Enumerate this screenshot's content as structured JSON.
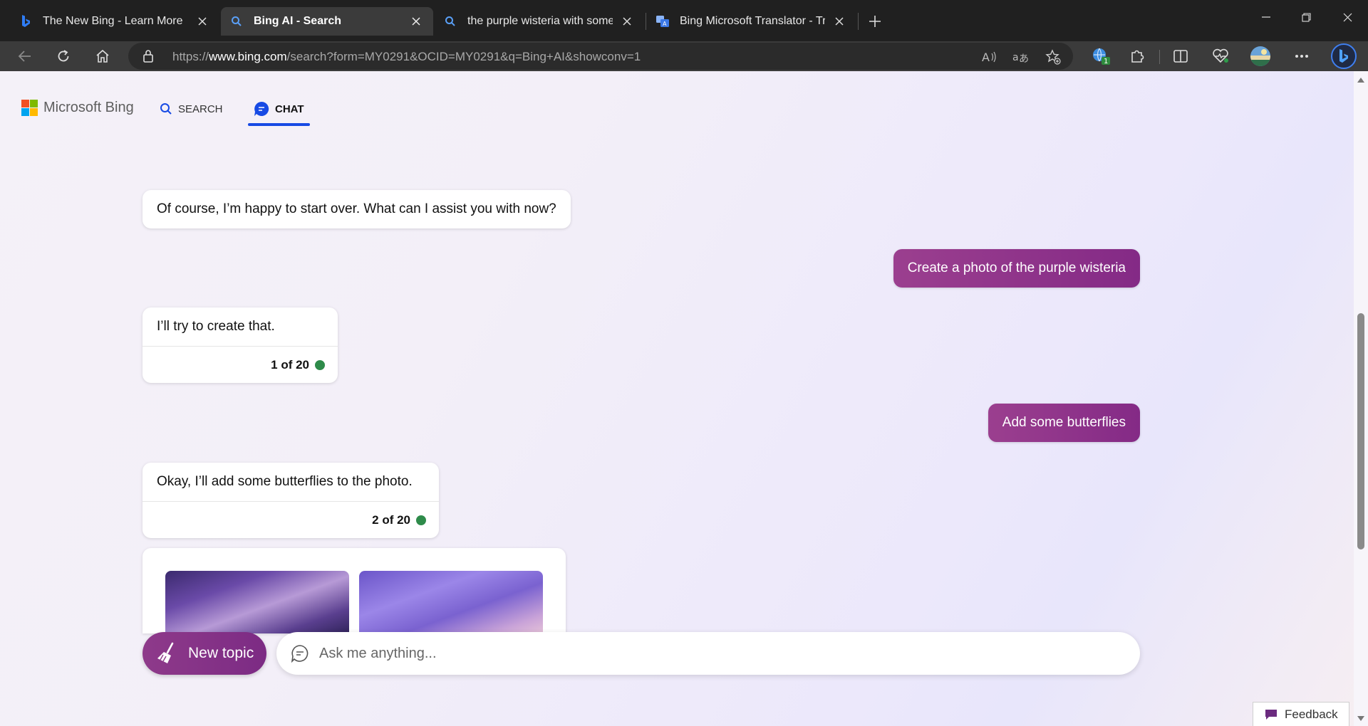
{
  "browser": {
    "tabs": [
      {
        "title": "The New Bing - Learn More",
        "favicon": "bing-icon"
      },
      {
        "title": "Bing AI - Search",
        "favicon": "search-icon"
      },
      {
        "title": "the purple wisteria with some bu",
        "favicon": "search-icon"
      },
      {
        "title": "Bing Microsoft Translator - Transl",
        "favicon": "translator-icon"
      }
    ],
    "url_prefix": "https://",
    "url_domain": "www.bing.com",
    "url_rest": "/search?form=MY0291&OCID=MY0291&q=Bing+AI&showconv=1",
    "extension_badge": "1"
  },
  "header": {
    "logo_text": "Microsoft Bing",
    "nav": [
      {
        "label": "SEARCH"
      },
      {
        "label": "CHAT"
      }
    ]
  },
  "conversation": {
    "messages": [
      {
        "role": "bot",
        "text": "Of course, I’m happy to start over. What can I assist you with now?"
      },
      {
        "role": "user",
        "text": "Create a photo of the purple wisteria"
      },
      {
        "role": "bot",
        "text": "I’ll try to create that.",
        "counter": "1 of 20"
      },
      {
        "role": "user",
        "text": "Add some butterflies"
      },
      {
        "role": "bot",
        "text": "Okay, I’ll add some butterflies to the photo.",
        "counter": "2 of 20"
      }
    ]
  },
  "composer": {
    "new_topic_label": "New topic",
    "placeholder": "Ask me anything..."
  },
  "feedback_label": "Feedback",
  "colors": {
    "accent_user_bubble": "#8a3088",
    "active_tab_underline": "#174ae4",
    "counter_dot": "#2e8b4a"
  }
}
